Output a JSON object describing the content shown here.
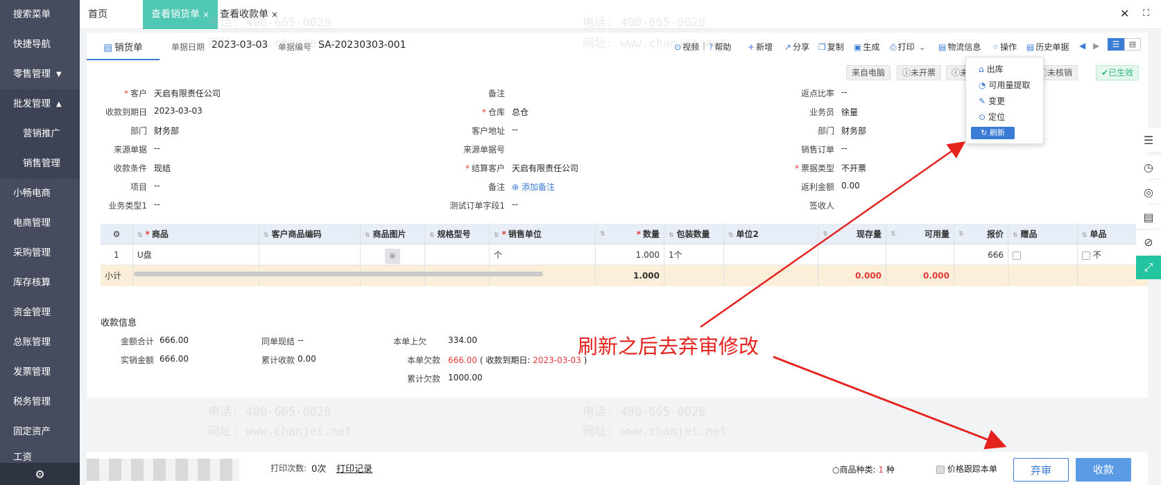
{
  "sidebar": {
    "items": [
      {
        "label": "搜索菜单"
      },
      {
        "label": "快捷导航"
      },
      {
        "label": "零售管理",
        "arrow": "▼"
      },
      {
        "label": "批发管理",
        "arrow": "▲"
      },
      {
        "label": "营销推广"
      },
      {
        "label": "销售管理"
      },
      {
        "label": "小畅电商"
      },
      {
        "label": "电商管理"
      },
      {
        "label": "采购管理"
      },
      {
        "label": "库存核算"
      },
      {
        "label": "资金管理"
      },
      {
        "label": "总账管理"
      },
      {
        "label": "发票管理"
      },
      {
        "label": "税务管理"
      },
      {
        "label": "固定资产"
      },
      {
        "label": "工资"
      }
    ]
  },
  "tabs": [
    {
      "label": "首页"
    },
    {
      "label": "查看销货单",
      "close": "×"
    },
    {
      "label": "查看收款单",
      "close": "×"
    }
  ],
  "header": {
    "doc_tab": "销货单",
    "date_label": "单据日期",
    "date_value": "2023-03-03",
    "no_label": "单据编号",
    "no_value": "SA-20230303-001",
    "tools": [
      "视频",
      "帮助",
      "新增",
      "分享",
      "复制",
      "生成",
      "打印",
      "物流信息",
      "操作",
      "历史单据"
    ]
  },
  "statuses": [
    "来自电脑",
    "未开票",
    "未",
    "未核销",
    "已生效"
  ],
  "popup": {
    "items": [
      "出库",
      "可用量提取",
      "变更",
      "定位"
    ],
    "refresh": "刷新"
  },
  "fields": {
    "customer_l": "客户",
    "customer_v": "天启有限责任公司",
    "remark1_l": "备注",
    "remark1_v": "",
    "rebate_rate_l": "返点比率",
    "rebate_rate_v": "--",
    "due_date_l": "收款到期日",
    "due_date_v": "2023-03-03",
    "warehouse_l": "仓库",
    "warehouse_v": "总仓",
    "salesman_l": "业务员",
    "salesman_v": "徐量",
    "dept_l": "部门",
    "dept_v": "财务部",
    "cust_addr_l": "客户地址",
    "cust_addr_v": "--",
    "dept2_l": "部门",
    "dept2_v": "财务部",
    "source_l": "来源单据",
    "source_v": "--",
    "source_no_l": "来源单据号",
    "source_no_v": "",
    "sales_order_l": "销售订单",
    "sales_order_v": "--",
    "pay_term_l": "收款条件",
    "pay_term_v": "现结",
    "settle_l": "结算客户",
    "settle_v": "天启有限责任公司",
    "invoice_type_l": "票据类型",
    "invoice_type_v": "不开票",
    "project_l": "项目",
    "project_v": "--",
    "remark2_l": "备注",
    "remark2_v": "添加备注",
    "rebate_amt_l": "返利金额",
    "rebate_amt_v": "0.00",
    "biz_type_l": "业务类型1",
    "biz_type_v": "--",
    "test_field_l": "测试订单字段1",
    "test_field_v": "--",
    "signer_l": "签收人",
    "signer_v": ""
  },
  "table": {
    "columns": [
      "",
      "商品",
      "客户商品编码",
      "商品图片",
      "规格型号",
      "销售单位",
      "数量",
      "包装数量",
      "单位2",
      "现存量",
      "可用量",
      "报价",
      "赠品",
      "单品"
    ],
    "row": {
      "no": "1",
      "product": "U盘",
      "unit": "个",
      "qty": "1.000",
      "pack_qty": "1个",
      "price": "666",
      "last": "不"
    },
    "sum": {
      "label": "小计",
      "qty": "1.000",
      "stock": "0.000",
      "avail": "0.000"
    }
  },
  "payment": {
    "title": "收款信息",
    "total_l": "金额合计",
    "total_v": "666.00",
    "cash_l": "同单现结",
    "cash_v": "--",
    "prev_owe_l": "本单上欠",
    "prev_owe_v": "334.00",
    "sales_l": "实销金额",
    "sales_v": "666.00",
    "acc_recv_l": "累计收款",
    "acc_recv_v": "0.00",
    "owe_l": "本单欠款",
    "owe_v": "666.00",
    "owe_note_pre": "( 收款到期日:",
    "owe_note_date": "2023-03-03",
    "owe_note_post": ")",
    "acc_owe_l": "累计欠款",
    "acc_owe_v": "1000.00"
  },
  "bottom": {
    "print_count_l": "打印次数:",
    "print_count_v": "0次",
    "print_record": "打印记录",
    "kinds_l": "商品种类:",
    "kinds_v": "1",
    "kinds_unit": "种",
    "price_track": "价格跟踪本单",
    "abandon": "弃审",
    "collect": "收款"
  },
  "annotation": "刷新之后去弃审修改",
  "watermark": {
    "phone": "电话: 400-665-0028",
    "site": "网址: www.chanjet.net"
  },
  "colors": {
    "accent": "#3a7bd5",
    "tab_active": "#4ec7b3",
    "annotation": "#e4231f",
    "sidebar": "#464c5e"
  }
}
